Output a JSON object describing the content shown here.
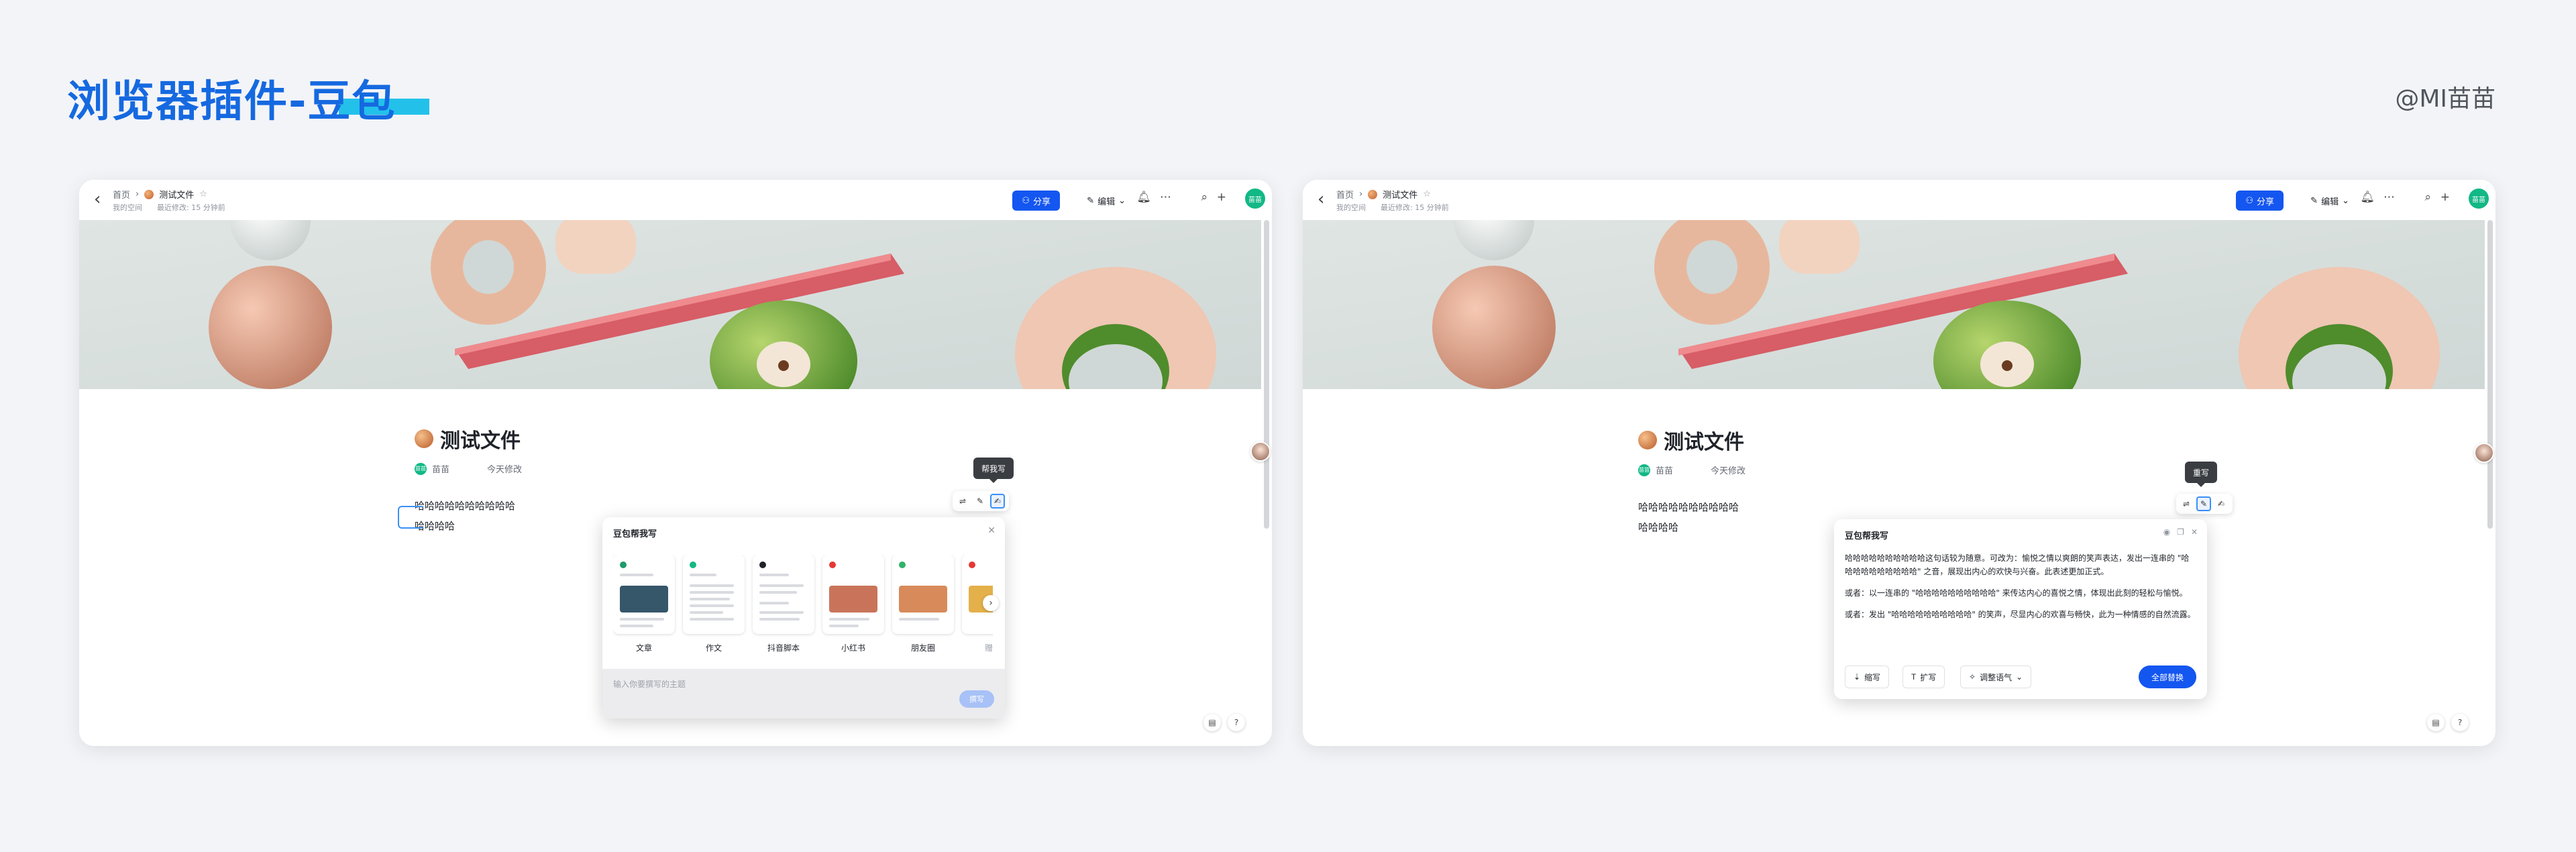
{
  "slide": {
    "title": "浏览器插件-豆包",
    "author": "@MI苗苗",
    "accent": "#1569e0"
  },
  "window": {
    "breadcrumb_root": "首页",
    "doc_name": "测试文件",
    "meta_space": "我的空间",
    "meta_modified": "最近修改: 15 分钟前",
    "share_label": "分享",
    "edit_label": "编辑",
    "avatar_text": "苗苗",
    "doc_title": "测试文件",
    "doc_author": "苗苗",
    "doc_time": "今天修改",
    "line1": "哈哈哈哈哈哈哈哈哈哈",
    "line2": "哈哈哈哈",
    "brand_blue": "#1456f0"
  },
  "left": {
    "tooltip": "帮我写",
    "panel_title": "豆包帮我写",
    "cards": [
      {
        "label": "文章",
        "dot": "#1f9a6b",
        "img": "#36566a"
      },
      {
        "label": "作文",
        "dot": "#12b886",
        "img": "#ffffff"
      },
      {
        "label": "抖音脚本",
        "dot": "#1f2329",
        "img": "#ffffff"
      },
      {
        "label": "小红书",
        "dot": "#e53935",
        "img": "#c9745a"
      },
      {
        "label": "朋友圈",
        "dot": "#2fb36b",
        "img": "#d88a5a"
      },
      {
        "label": "赠言",
        "dot": "#e53935",
        "img": "#e4b04a"
      }
    ],
    "input_placeholder": "输入你要撰写的主题",
    "send_label": "撰写"
  },
  "right": {
    "tooltip": "重写",
    "panel_title": "豆包帮我写",
    "paragraphs": [
      "哈哈哈哈哈哈哈哈哈哈这句话较为随意。可改为：愉悦之情以爽朗的笑声表达，发出一连串的 \"哈哈哈哈哈哈哈哈哈哈\" 之音，展现出内心的欢快与兴奋。此表述更加正式。",
      "或者：以一连串的 \"哈哈哈哈哈哈哈哈哈哈\" 来传达内心的喜悦之情，体现出此刻的轻松与愉悦。",
      "或者：发出 \"哈哈哈哈哈哈哈哈哈哈\" 的笑声，尽显内心的欢喜与畅快，此为一种情感的自然流露。"
    ],
    "btn_shorten": "缩写",
    "btn_expand": "扩写",
    "btn_tone": "调整语气",
    "btn_replace": "全部替换"
  }
}
